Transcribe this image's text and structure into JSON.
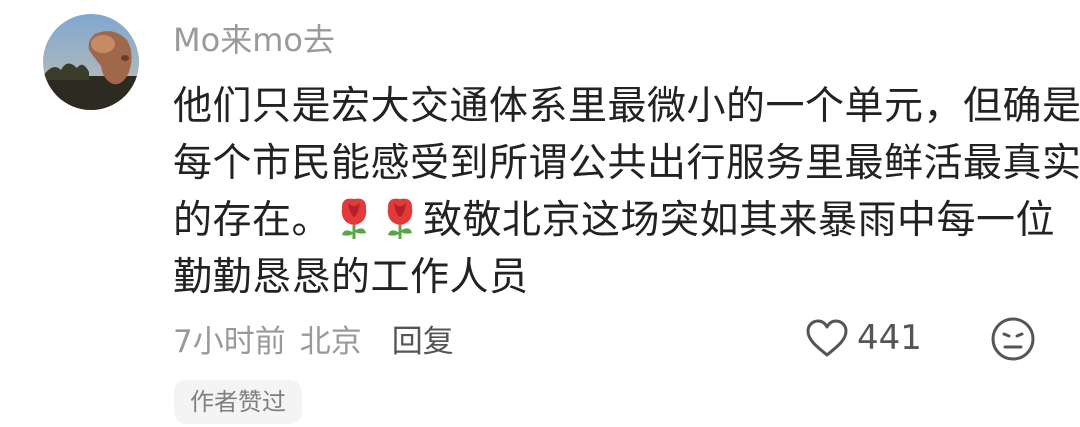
{
  "comment": {
    "username": "Mo来mo去",
    "body_lines": [
      "他们只是宏大交通体系里最微小的一个单元，但确是",
      "每个市民能感受到所谓公共出行服务里最鲜活最真实",
      "的存在。",
      "致敬北京这场突如其来暴雨中每一位",
      "勤勤恳恳的工作人员"
    ],
    "emoji": [
      "rose-emoji",
      "rose-emoji"
    ],
    "time": "7小时前",
    "location": "北京",
    "reply_label": "回复",
    "like_count": "441",
    "author_badge": "作者赞过"
  },
  "colors": {
    "username": "#9a9a9a",
    "body": "#222222",
    "meta": "#999999",
    "badge_bg": "#f4f4f4",
    "rose": "#e03a3a",
    "leaf": "#5aa545"
  },
  "icons": {
    "like": "heart-outline-icon",
    "dislike": "neutral-face-icon"
  }
}
